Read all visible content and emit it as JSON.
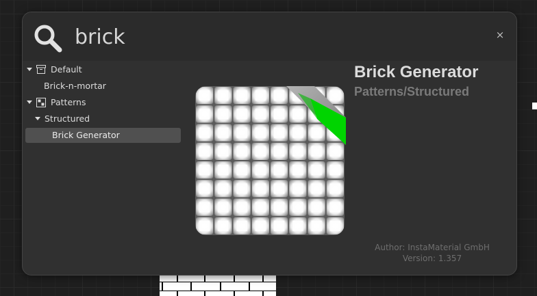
{
  "search": {
    "query": "brick",
    "close_label": "×"
  },
  "tree": {
    "items": [
      {
        "label": "Default",
        "icon": "archive-box-icon",
        "expanded": true
      },
      {
        "label": "Brick-n-mortar"
      },
      {
        "label": "Patterns",
        "icon": "pattern-grid-icon",
        "expanded": true
      },
      {
        "label": "Structured",
        "expanded": true
      },
      {
        "label": "Brick Generator",
        "selected": true
      }
    ]
  },
  "details": {
    "title": "Brick Generator",
    "category_path": "Patterns/Structured",
    "author": "Author: InstaMaterial GmbH",
    "version": "Version: 1.357"
  },
  "preview": {
    "icon": "tile-pattern-preview-icon",
    "tile_color": "#ffffff",
    "ribbon_gray": "#9a9a9a",
    "ribbon_green": "#00d400"
  },
  "colors": {
    "dialog_bg": "#303030",
    "selected_row": "#505050",
    "text": "#dcdcdc",
    "muted_text": "#7a7a7a"
  }
}
